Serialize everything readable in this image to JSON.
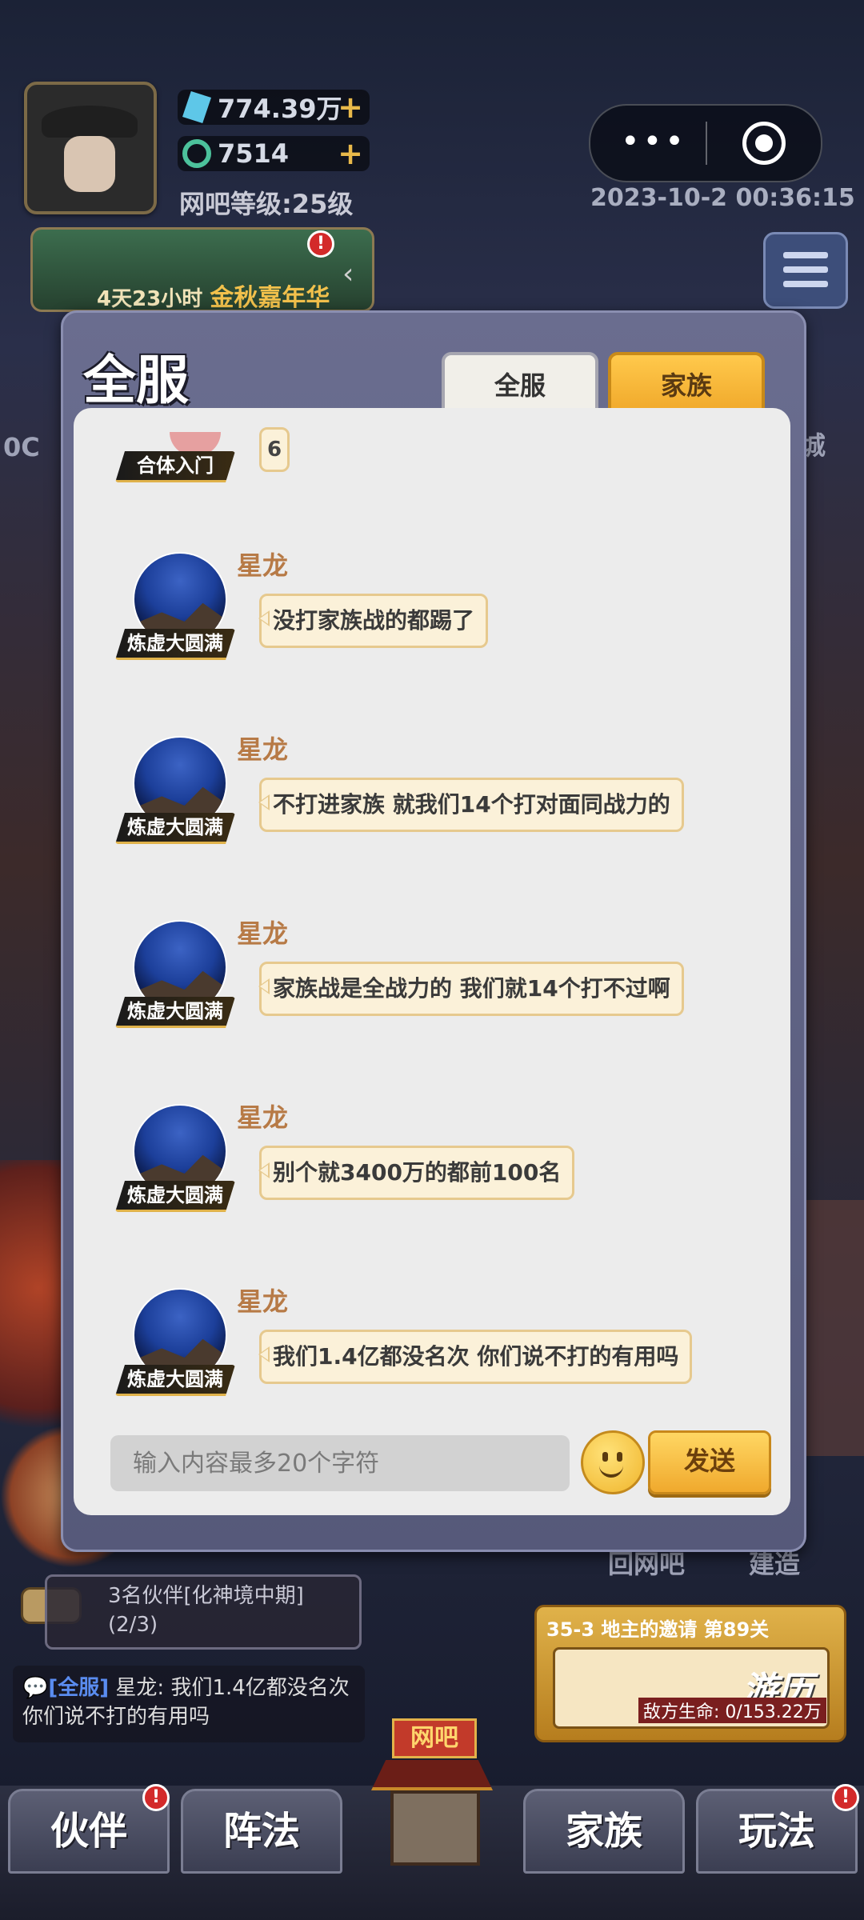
{
  "hud": {
    "crystal_value": "774.39万",
    "jade_value": "7514",
    "plus_symbol": "+",
    "netbar_level": "网吧等级:25级",
    "datetime": "2023-10-2  00:36:15"
  },
  "event": {
    "countdown": "4天23小时",
    "name": "金秋嘉年华",
    "badge": "!"
  },
  "chat_panel": {
    "title": "全服",
    "tabs": [
      "全服",
      "家族"
    ],
    "active_tab": "家族",
    "partial_message": {
      "rank": "合体入门",
      "text": "6"
    },
    "messages": [
      {
        "name": "星龙",
        "rank": "炼虚大圆满",
        "text": "没打家族战的都踢了"
      },
      {
        "name": "星龙",
        "rank": "炼虚大圆满",
        "text": "不打进家族 就我们14个打对面同战力的"
      },
      {
        "name": "星龙",
        "rank": "炼虚大圆满",
        "text": "家族战是全战力的  我们就14个打不过啊"
      },
      {
        "name": "星龙",
        "rank": "炼虚大圆满",
        "text": "别个就3400万的都前100名"
      },
      {
        "name": "星龙",
        "rank": "炼虚大圆满",
        "text": "我们1.4亿都没名次 你们说不打的有用吗"
      }
    ],
    "input_placeholder": "输入内容最多20个字符",
    "send_label": "发送"
  },
  "behind": {
    "left_label": "0C",
    "right_label": "城",
    "back_netbar": "回网吧",
    "build": "建造"
  },
  "task": {
    "text": "3名伙伴[化神境中期](2/3)"
  },
  "ticker": {
    "channel": "[全服]",
    "text": " 星龙: 我们1.4亿都没名次 你们说不打的有用吗"
  },
  "stage": {
    "title": "35-3 地主的邀请 第89关",
    "action": "游历",
    "enemy_hp": "敌方生命: 0/153.22万"
  },
  "bottom_nav": {
    "items": [
      "伙伴",
      "阵法",
      "家族",
      "玩法"
    ],
    "center_sign": "网吧"
  },
  "colors": {
    "accent_gold": "#f0a82a",
    "name_brown": "#b77a46",
    "bubble_bg": "#fbf1d9",
    "badge_red": "#d32a2a"
  }
}
